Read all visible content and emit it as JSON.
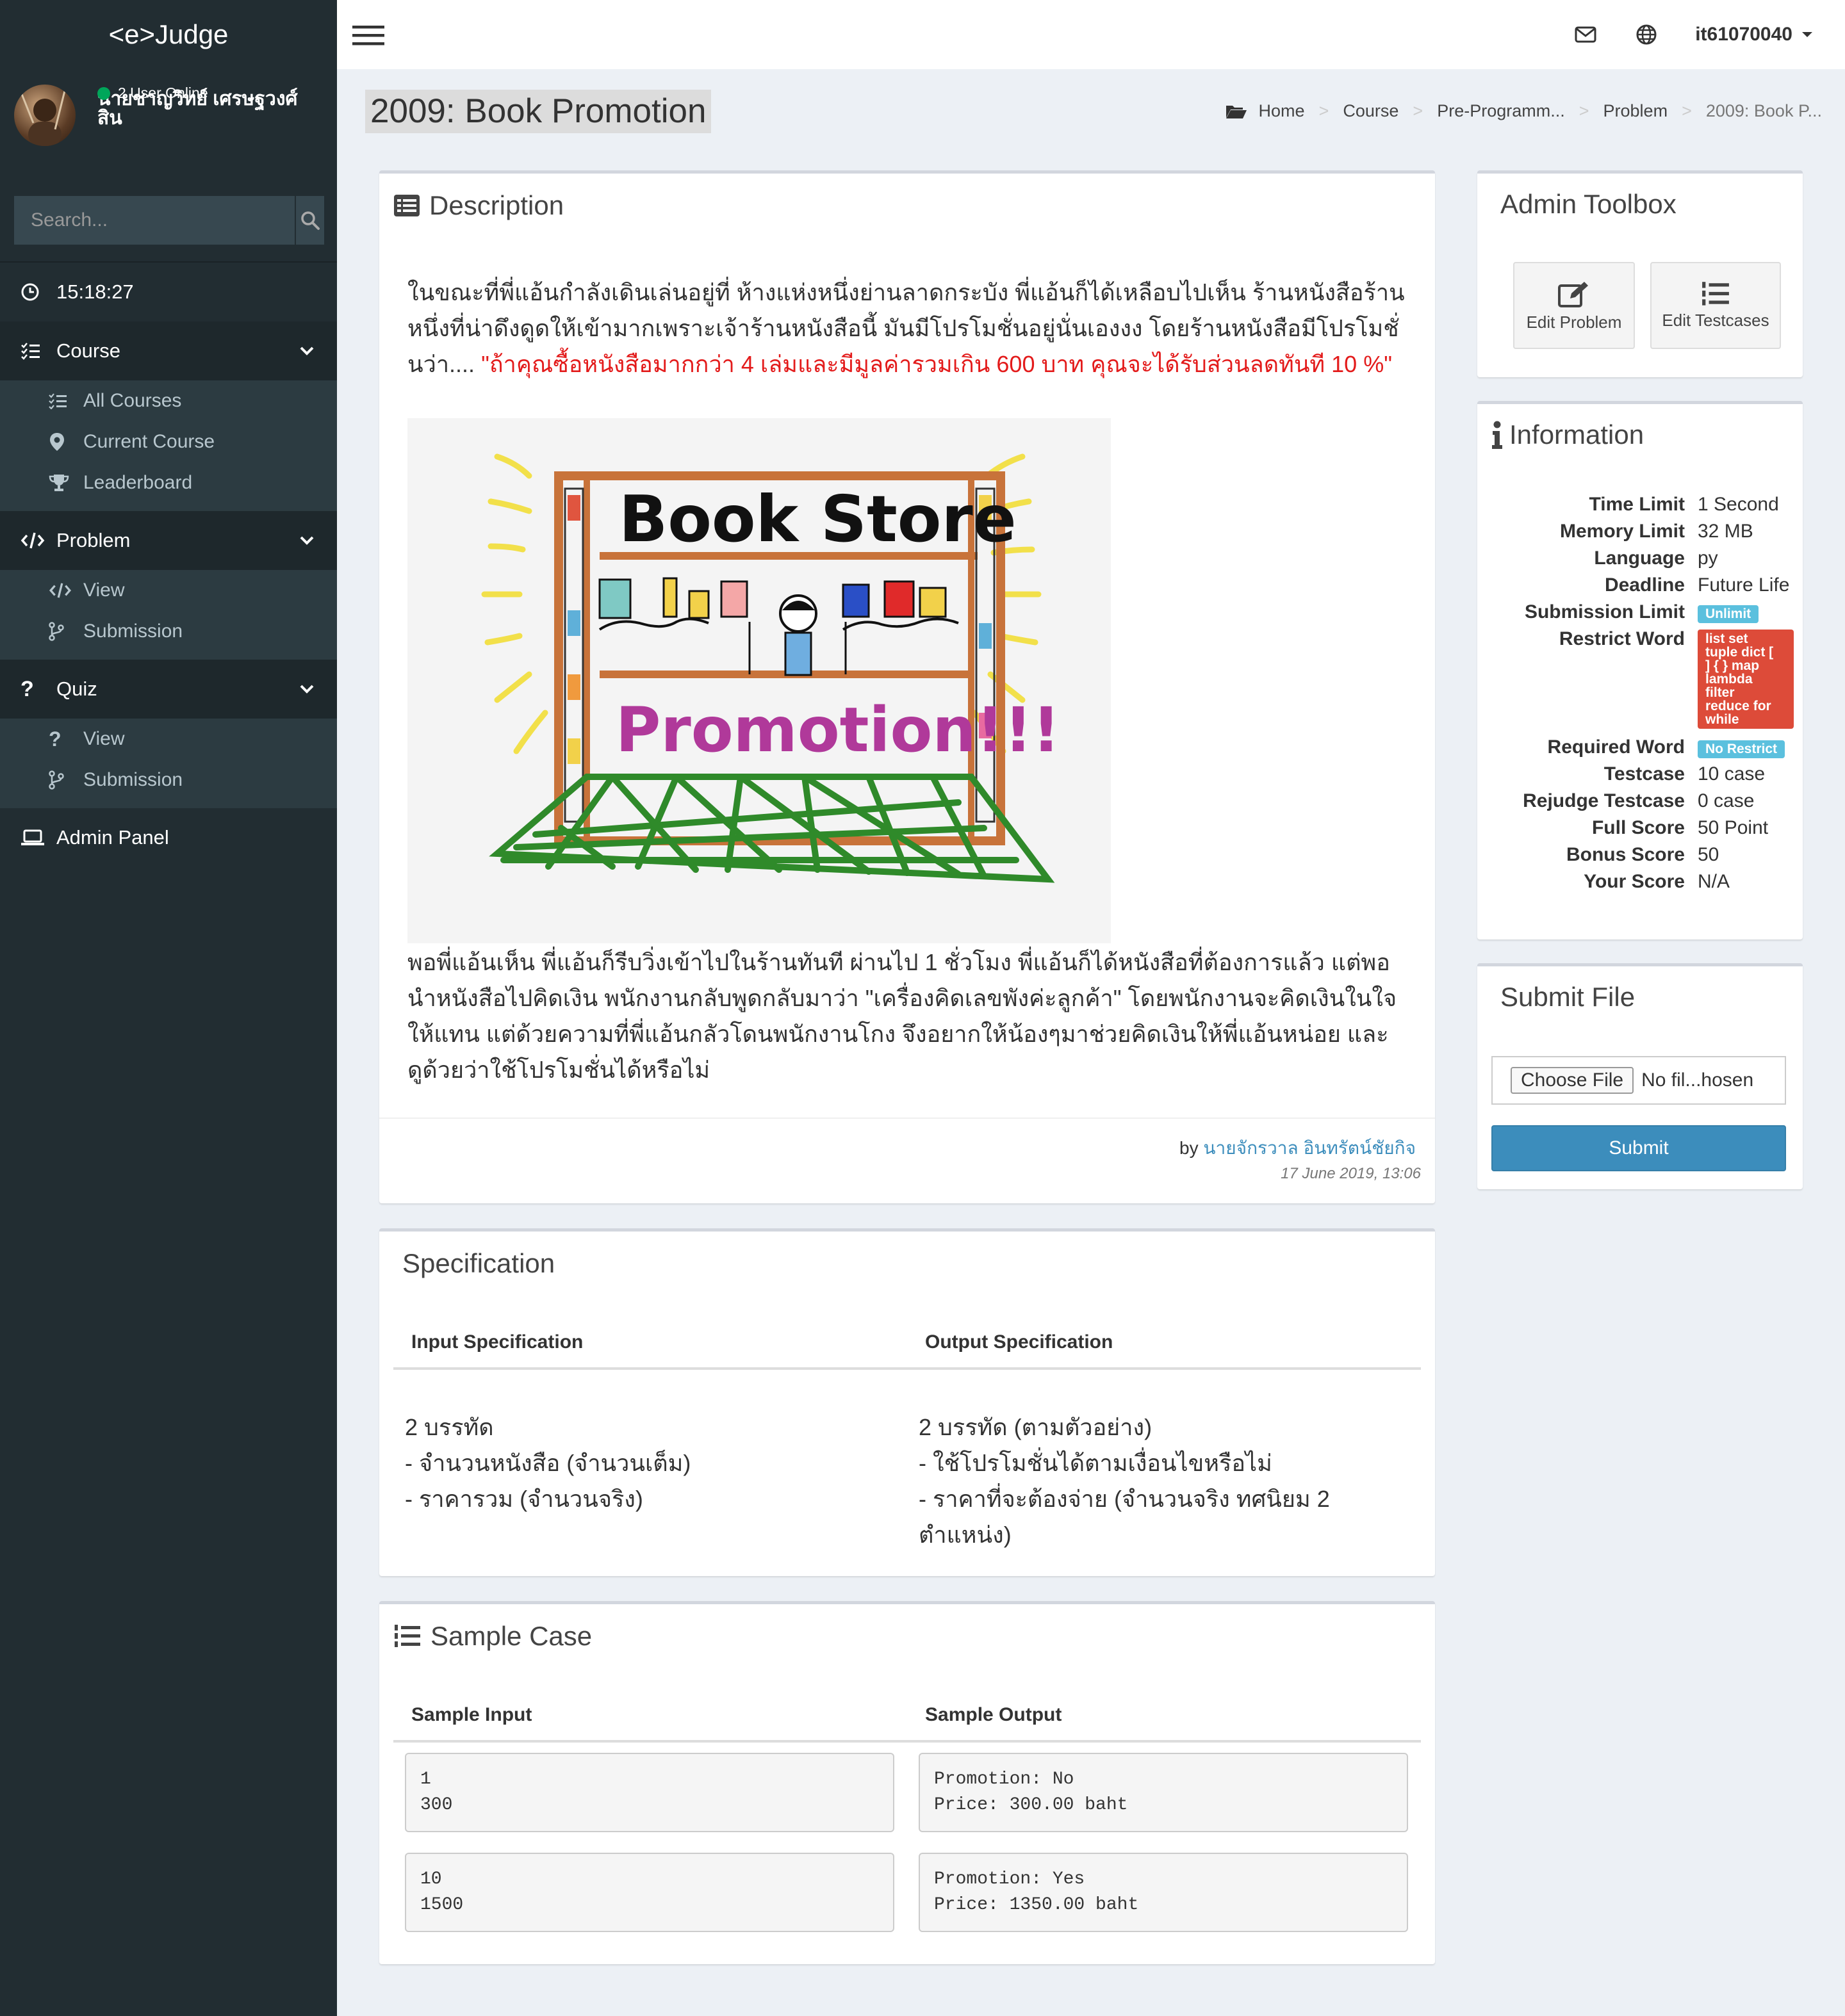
{
  "sidebar": {
    "logo": "<e>Judge",
    "user_name": "นายชาญวิทย์ เศรษฐวงศ์สิน",
    "online_text": "2 User Online",
    "search_placeholder": "Search...",
    "clock": "15:18:27",
    "course": {
      "label": "Course",
      "items": [
        "All Courses",
        "Current Course",
        "Leaderboard"
      ]
    },
    "problem": {
      "label": "Problem",
      "items": [
        "View",
        "Submission"
      ]
    },
    "quiz": {
      "label": "Quiz",
      "items": [
        "View",
        "Submission"
      ]
    },
    "admin_panel": "Admin Panel"
  },
  "topbar": {
    "username": "it61070040"
  },
  "page": {
    "title": "2009: Book Promotion",
    "breadcrumb": [
      "Home",
      "Course",
      "Pre-Programm...",
      "Problem",
      "2009: Book P..."
    ]
  },
  "description": {
    "title": "Description",
    "para1_normal": "ในขณะที่พี่แอ้นกำลังเดินเล่นอยู่ที่ ห้างแห่งหนึ่งย่านลาดกระบัง พี่แอ้นก็ได้เหลือบไปเห็น ร้านหนังสือร้านหนึ่งที่น่าดึงดูดให้เข้ามากเพราะเจ้าร้านหนังสือนี้ มันมีโปรโมชั่นอยู่นั่นเองงง โดยร้านหนังสือมีโปรโมชั่นว่า.... ",
    "para1_red": "\"ถ้าคุณซื้อหนังสือมากกว่า 4 เล่มและมีมูลค่ารวมเกิน 600 บาท คุณจะได้รับส่วนลดทันที 10 %\"",
    "image_title": "Book Store",
    "image_subtitle": "Promotion!!!",
    "para2": "พอพี่แอ้นเห็น พี่แอ้นก็รีบวิ่งเข้าไปในร้านทันที  ผ่านไป 1 ชั่วโมง พี่แอ้นก็ได้หนังสือที่ต้องการแล้ว แต่พอนำหนังสือไปคิดเงิน พนักงานกลับพูดกลับมาว่า \"เครื่องคิดเลขพังค่ะลูกค้า\" โดยพนักงานจะคิดเงินในใจให้แทน แต่ด้วยความที่พี่แอ้นกลัวโดนพนักงานโกง จึงอยากให้น้องๆมาช่วยคิดเงินให้พี่แอ้นหน่อย และ ดูด้วยว่าใช้โปรโมชั่นได้หรือไม่",
    "by_label": "by",
    "author": "นายจักรวาล อินทรัตน์ชัยกิจ",
    "date": "17 June 2019, 13:06"
  },
  "specification": {
    "title": "Specification",
    "input_header": "Input Specification",
    "output_header": "Output Specification",
    "input_lines": [
      "2 บรรทัด",
      "- จำนวนหนังสือ (จำนวนเต็ม)",
      "- ราคารวม (จำนวนจริง)"
    ],
    "output_lines": [
      "2 บรรทัด (ตามตัวอย่าง)",
      "- ใช้โปรโมชั่นได้ตามเงื่อนไขหรือไม่",
      "- ราคาที่จะต้องจ่าย (จำนวนจริง ทศนิยม 2",
      "ตำแหน่ง)"
    ]
  },
  "sample": {
    "title": "Sample Case",
    "input_header": "Sample Input",
    "output_header": "Sample Output",
    "cases": [
      {
        "input": "1\n300",
        "output": "Promotion: No\nPrice: 300.00 baht"
      },
      {
        "input": "10\n1500",
        "output": "Promotion: Yes\nPrice: 1350.00 baht"
      }
    ]
  },
  "admin_toolbox": {
    "title": "Admin Toolbox",
    "edit_problem": "Edit Problem",
    "edit_testcases": "Edit Testcases"
  },
  "information": {
    "title": "Information",
    "rows": [
      {
        "k": "Time Limit",
        "v": "1 Second"
      },
      {
        "k": "Memory Limit",
        "v": "32 MB"
      },
      {
        "k": "Language",
        "v": "py"
      },
      {
        "k": "Deadline",
        "v": "Future Life"
      },
      {
        "k": "Submission Limit",
        "v": "Unlimit"
      },
      {
        "k": "Restrict Word",
        "v": "list set tuple dict [ ] { } map lambda filter reduce for while"
      },
      {
        "k": "Required Word",
        "v": "No Restrict"
      },
      {
        "k": "Testcase",
        "v": "10 case"
      },
      {
        "k": "Rejudge Testcase",
        "v": "0 case"
      },
      {
        "k": "Full Score",
        "v": "50 Point"
      },
      {
        "k": "Bonus Score",
        "v": "50"
      },
      {
        "k": "Your Score",
        "v": "N/A"
      }
    ],
    "restrict_lines": [
      "list set",
      "tuple dict [",
      "] { } map",
      "lambda",
      "filter",
      "reduce for",
      "while"
    ]
  },
  "submit_file": {
    "title": "Submit File",
    "choose_label": "Choose File",
    "no_file": "No fil...hosen",
    "submit_label": "Submit"
  },
  "colors": {
    "sidebar": "#222d32",
    "primary": "#3c8dbc",
    "info": "#5bc0de",
    "danger": "#dd4b39",
    "red_text": "#e31b1b"
  }
}
